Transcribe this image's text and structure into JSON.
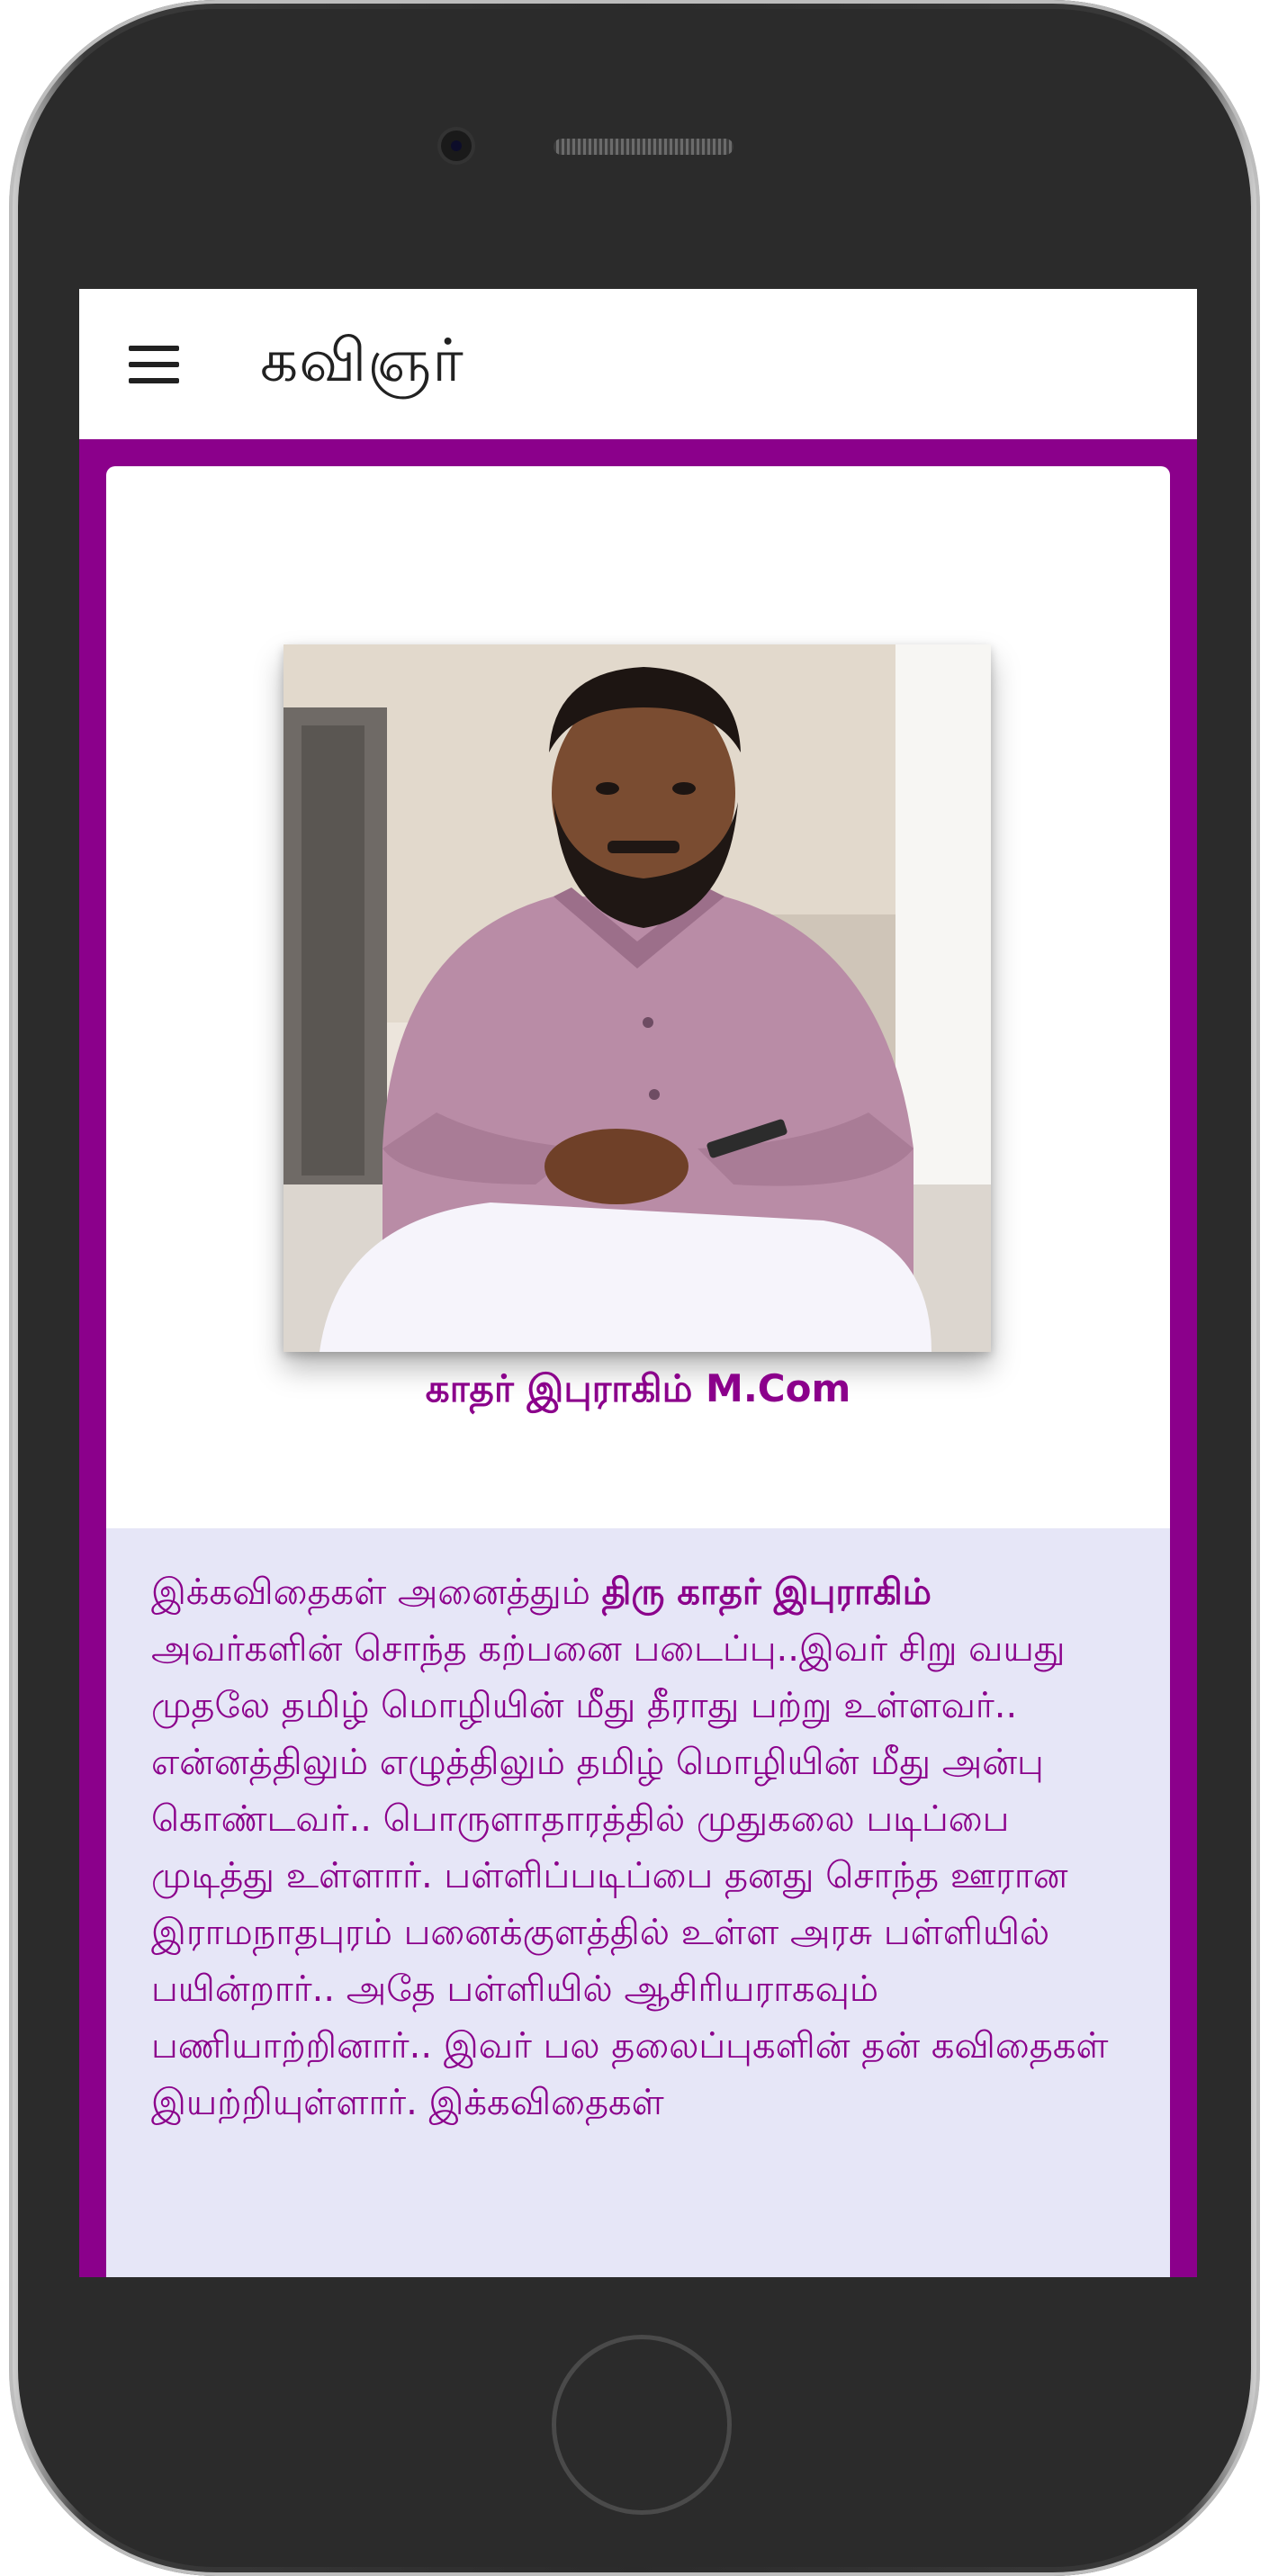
{
  "app_bar": {
    "title": "கவிஞர்",
    "menu_icon": "hamburger-menu-icon"
  },
  "profile": {
    "photo_alt": "portrait-photo",
    "caption": "காதர் இபுராகிம் M.Com"
  },
  "bio": {
    "lead": "இக்கவிதைகள் அனைத்தும் ",
    "name_bold": "திரு காதர் இபுராகிம்",
    "body": " அவர்களின் சொந்த கற்பனை படைப்பு..இவர் சிறு வயது முதலே தமிழ் மொழியின் மீது தீராது பற்று உள்ளவர்.. என்னத்திலும் எழுத்திலும் தமிழ் மொழியின் மீது அன்பு கொண்டவர்.. பொருளாதாரத்தில் முதுகலை படிப்பை முடித்து உள்ளார். பள்ளிப்படிப்பை தனது சொந்த ஊரான இராமநாதபுரம் பனைக்குளத்தில் உள்ள அரசு பள்ளியில் பயின்றார்.. அதே பள்ளியில் ஆசிரியராகவும் பணியாற்றினார்.. இவர் பல தலைப்புகளின் தன் கவிதைகள் இயற்றியுள்ளார். இக்கவிதைகள்"
  },
  "colors": {
    "accent": "#8b008b",
    "bio_background": "#e6e6f7",
    "app_bar": "#ffffff"
  }
}
